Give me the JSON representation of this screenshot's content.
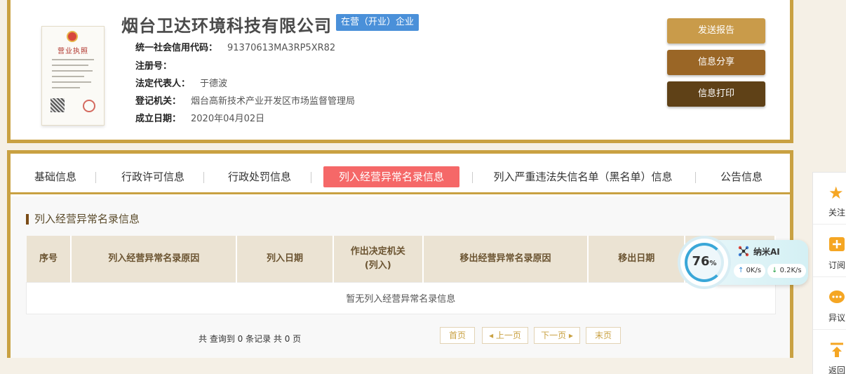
{
  "company": {
    "name": "烟台卫达环境科技有限公司",
    "status": "在营（开业）企业",
    "license_title": "营业执照"
  },
  "info": [
    {
      "label": "统一社会信用代码：",
      "value": "91370613MA3RP5XR82"
    },
    {
      "label": "注册号：",
      "value": ""
    },
    {
      "label": "法定代表人：",
      "value": "于德波"
    },
    {
      "label": "登记机关：",
      "value": "烟台高新技术产业开发区市场监督管理局"
    },
    {
      "label": "成立日期：",
      "value": "2020年04月02日"
    }
  ],
  "actions": {
    "report": "发送报告",
    "share": "信息分享",
    "print": "信息打印"
  },
  "tabs": [
    {
      "label": "基础信息"
    },
    {
      "label": "行政许可信息"
    },
    {
      "label": "行政处罚信息"
    },
    {
      "label": "列入经营异常名录信息"
    },
    {
      "label": "列入严重违法失信名单（黑名单）信息"
    },
    {
      "label": "公告信息"
    }
  ],
  "section": {
    "title": "列入经营异常名录信息",
    "columns": [
      "序号",
      "列入经营异常名录原因",
      "列入日期",
      "作出决定机关\n(列入)",
      "移出经营异常名录原因",
      "移出日期",
      ""
    ],
    "empty_text": "暂无列入经营异常名录信息"
  },
  "pagination": {
    "summary": "共 查询到 0 条记录 共 0 页",
    "first": "首页",
    "prev": "上一页",
    "next": "下一页",
    "last": "末页"
  },
  "widget": {
    "percent": "76",
    "percent_unit": "%",
    "name": "纳米AI",
    "upload": "0K/s",
    "download": "0.2K/s"
  },
  "sidebar": [
    {
      "label": "关注",
      "icon": "star-icon"
    },
    {
      "label": "订阅",
      "icon": "plus-icon"
    },
    {
      "label": "异议",
      "icon": "chat-icon"
    },
    {
      "label": "返回",
      "icon": "arrow-up-icon"
    }
  ]
}
